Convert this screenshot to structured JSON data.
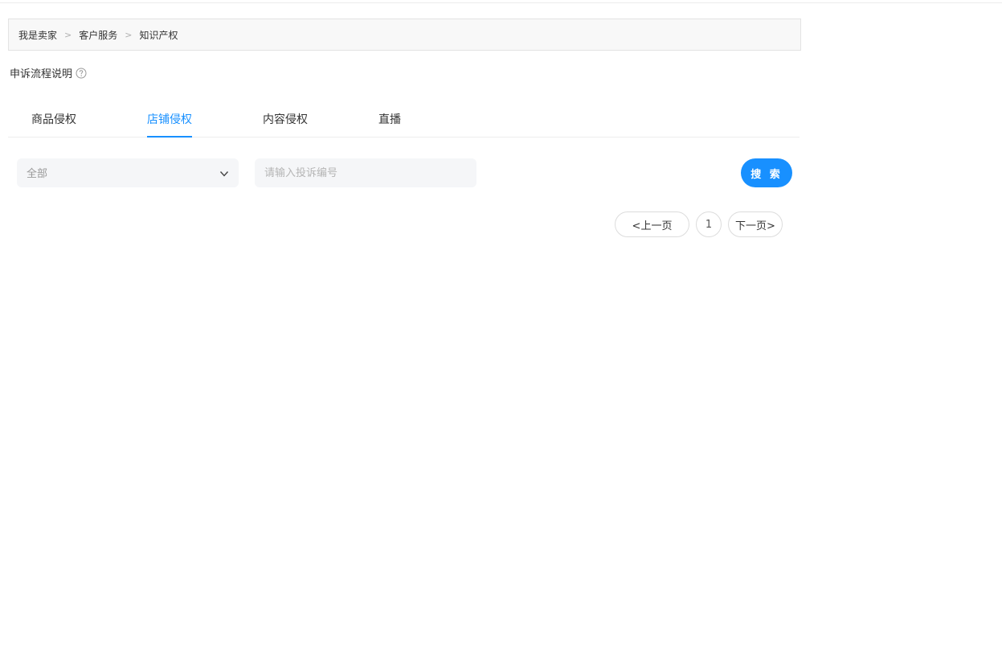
{
  "breadcrumb": {
    "items": [
      "我是卖家",
      "客户服务",
      "知识产权"
    ],
    "separator": ">"
  },
  "appeal": {
    "label": "申诉流程说明",
    "icon": "question-circle-icon"
  },
  "tabs": [
    {
      "label": "商品侵权",
      "active": false
    },
    {
      "label": "店铺侵权",
      "active": true
    },
    {
      "label": "内容侵权",
      "active": false
    },
    {
      "label": "直播",
      "active": false
    }
  ],
  "filter": {
    "select_value": "全部",
    "search_placeholder": "请输入投诉编号",
    "search_button": "搜 索"
  },
  "pagination": {
    "prev": "<上一页",
    "current": "1",
    "next": "下一页>"
  },
  "colors": {
    "accent": "#1890ff",
    "field_bg": "#f5f6f8",
    "breadcrumb_bg": "#f8f8f8"
  }
}
